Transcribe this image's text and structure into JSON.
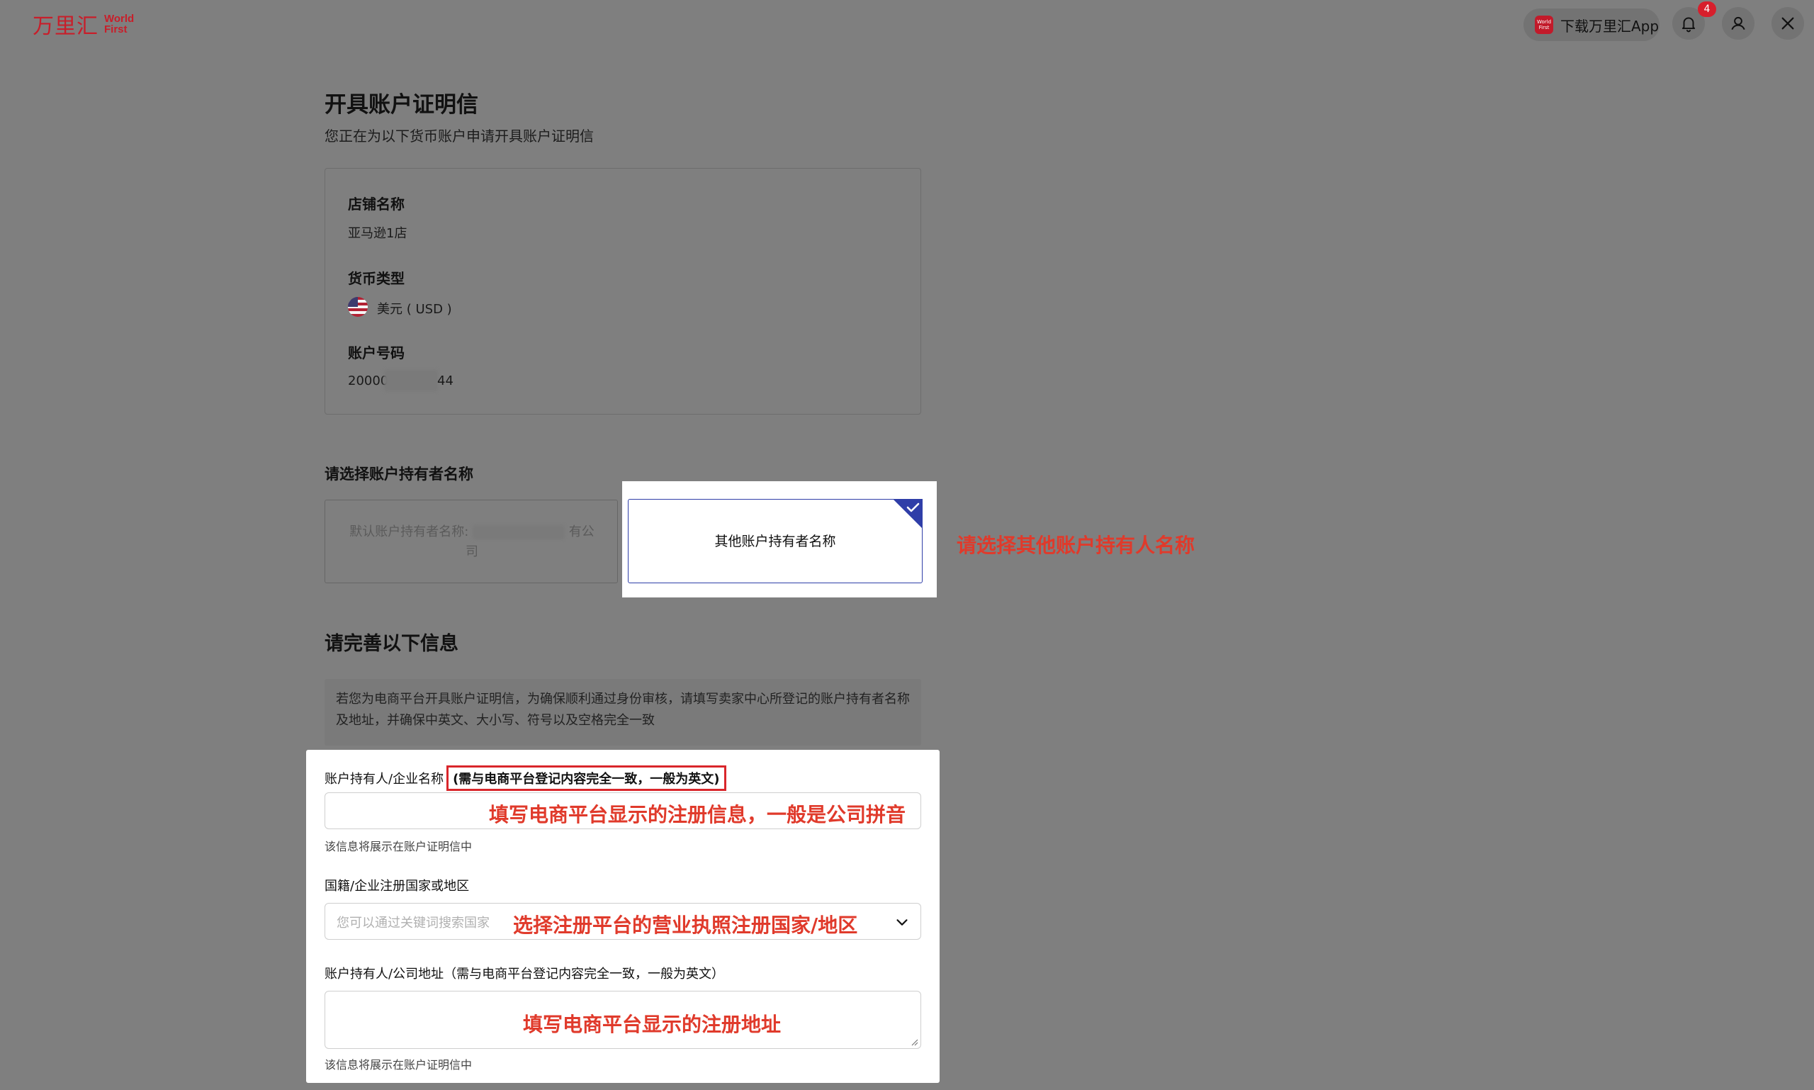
{
  "header": {
    "logo_cn": "万里汇",
    "logo_en_line1": "World",
    "logo_en_line2": "First",
    "app_icon_text": "World First",
    "download_app_label": "下载万里汇App",
    "notification_count": "4"
  },
  "page": {
    "title": "开具账户证明信",
    "subtitle": "您正在为以下货币账户申请开具账户证明信"
  },
  "account_info": {
    "store_label": "店铺名称",
    "store_value": "亚马逊1店",
    "currency_label": "货币类型",
    "currency_value": "美元 ( USD )",
    "account_label": "账户号码",
    "account_prefix": "20000",
    "account_suffix": "44"
  },
  "holder_select": {
    "label": "请选择账户持有者名称",
    "default_option_prefix": "默认账户持有者名称:",
    "default_option_visible_tail": "有公",
    "default_option_line2": "司",
    "other_option_label": "其他账户持有者名称",
    "annotation": "请选择其他账户持有人名称"
  },
  "form": {
    "section_title": "请完善以下信息",
    "notice": "若您为电商平台开具账户证明信，为确保顺利通过身份审核，请填写卖家中心所登记的账户持有者名称及地址，并确保中英文、大小写、符号以及空格完全一致",
    "name_label": "账户持有人/企业名称",
    "name_label_highlight": "(需与电商平台登记内容完全一致，一般为英文)",
    "name_annotation": "填写电商平台显示的注册信息，一般是公司拼音",
    "name_hint": "该信息将展示在账户证明信中",
    "country_label": "国籍/企业注册国家或地区",
    "country_placeholder": "您可以通过关键词搜索国家",
    "country_annotation": "选择注册平台的营业执照注册国家/地区",
    "address_label": "账户持有人/公司地址（需与电商平台登记内容完全一致，一般为英文）",
    "address_annotation": "填写电商平台显示的注册地址",
    "address_hint": "该信息将展示在账户证明信中"
  },
  "colors": {
    "overlay_bg": "#7f7f7f",
    "brand_red": "#c81e2a",
    "annotation_red": "#e03a2b",
    "selected_blue": "#2f3ea8"
  }
}
